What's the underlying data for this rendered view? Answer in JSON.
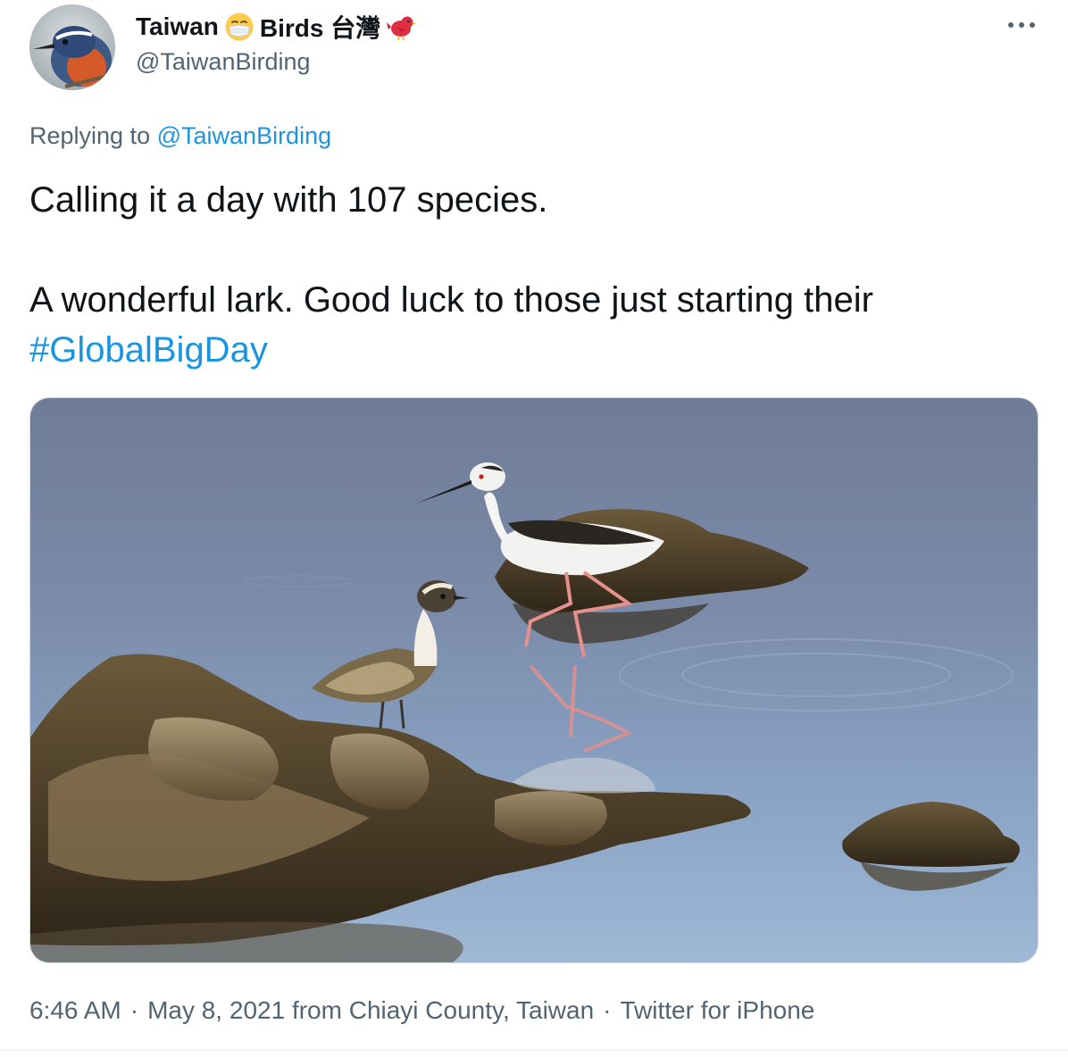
{
  "author": {
    "name_part1": "Taiwan",
    "name_part2": "Birds 台灣",
    "emoji1": "face-with-medical-mask-icon",
    "emoji2": "red-bird-icon",
    "handle": "@TaiwanBirding",
    "avatar": "avatar-bird-photo"
  },
  "more_icon": "more-horizontal-icon",
  "reply": {
    "prefix": "Replying to",
    "mention": "@TaiwanBirding"
  },
  "text": {
    "line1": "Calling it a day with 107 species.",
    "line2": "A wonderful lark. Good luck to those just starting their",
    "hashtag": "#GlobalBigDay"
  },
  "media": {
    "type": "photo",
    "subject": "shorebirds-in-shallow-water"
  },
  "meta": {
    "time": "6:46 AM",
    "dot": "·",
    "date_location": "May 8, 2021 from Chiayi County, Taiwan",
    "client": "Twitter for iPhone"
  },
  "colors": {
    "link": "#1b95e0",
    "secondary_text": "#536471",
    "primary_text": "#0f1419"
  }
}
